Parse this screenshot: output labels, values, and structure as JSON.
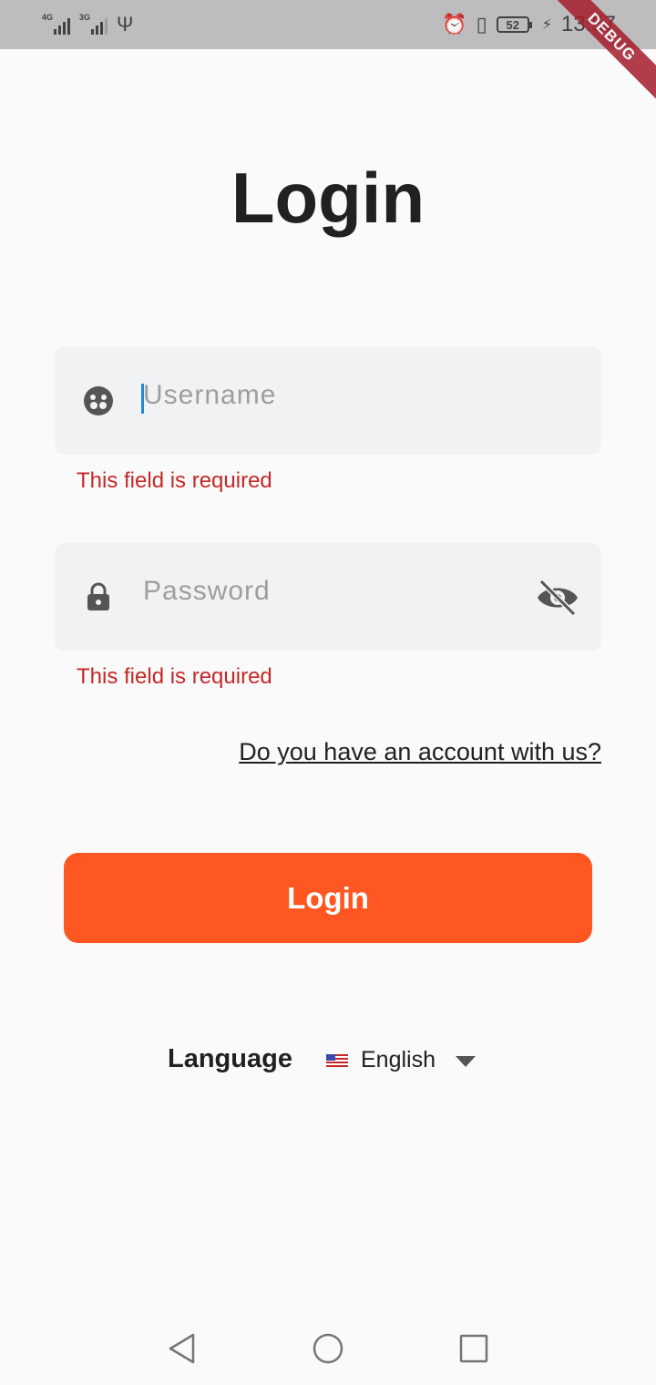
{
  "status_bar": {
    "network1": "4G",
    "network2": "3G",
    "battery": "52",
    "time": "13:57",
    "debug": "DEBUG"
  },
  "page": {
    "title": "Login"
  },
  "username": {
    "placeholder": "Username",
    "icon": "face-icon",
    "error": "This field is required"
  },
  "password": {
    "placeholder": "Password",
    "icon": "lock-icon",
    "toggle_icon": "visibility-off-icon",
    "error": "This field is required"
  },
  "account_link": "Do you have an account with us?",
  "login_button": "Login",
  "language": {
    "label": "Language",
    "selected": "English",
    "flag": "us-flag-icon"
  },
  "colors": {
    "accent": "#ff5722",
    "error": "#c62828",
    "field_bg": "#f1f2f4",
    "caret": "#1e88e5"
  }
}
